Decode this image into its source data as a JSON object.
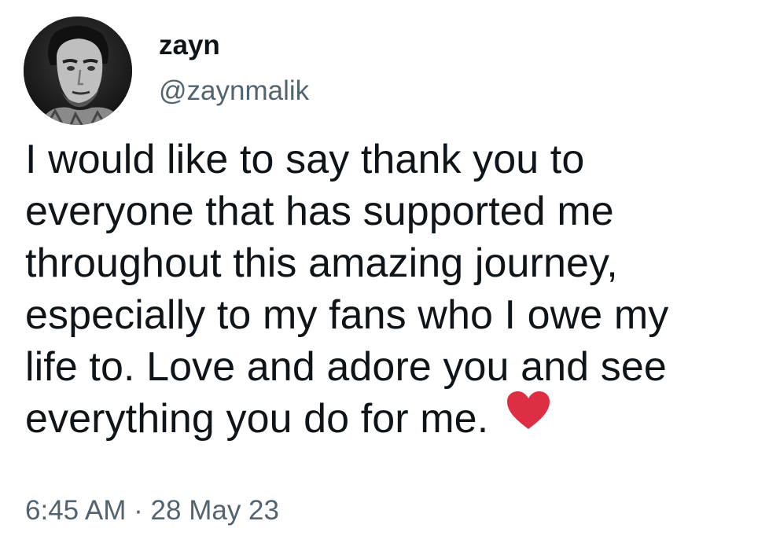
{
  "user": {
    "display_name": "zayn",
    "handle": "@zaynmalik"
  },
  "tweet": {
    "lines": [
      "I would like to say thank you to",
      "everyone that has supported me",
      "throughout this amazing journey,",
      "especially to my fans who I owe my",
      "life to. Love and adore you and see",
      "everything you do for me."
    ],
    "emoji": "heart-icon",
    "time": "6:45 AM",
    "separator": "·",
    "date": "28 May 23"
  },
  "colors": {
    "text": "#0f1419",
    "secondary": "#536471",
    "heart": "#dd2e44",
    "background": "#ffffff"
  }
}
